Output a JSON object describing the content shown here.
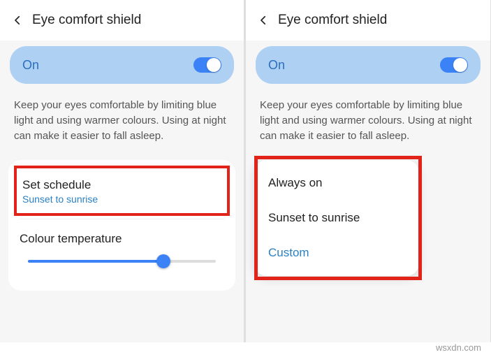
{
  "left": {
    "header_title": "Eye comfort shield",
    "toggle_label": "On",
    "description": "Keep your eyes comfortable by limiting blue light and using warmer colours. Using at night can make it easier to fall asleep.",
    "schedule_title": "Set schedule",
    "schedule_value": "Sunset to sunrise",
    "colour_temp_label": "Colour temperature",
    "slider_percent": 72
  },
  "right": {
    "header_title": "Eye comfort shield",
    "toggle_label": "On",
    "description": "Keep your eyes comfortable by limiting blue light and using warmer colours. Using at night can make it easier to fall asleep.",
    "options": {
      "always_on": "Always on",
      "sunset": "Sunset to sunrise",
      "custom": "Custom"
    }
  },
  "watermark": "wsxdn.com",
  "colors": {
    "accent": "#3b82f6",
    "highlight": "#e2231a",
    "link": "#2b80c4",
    "card_blue": "#aed0f2"
  }
}
